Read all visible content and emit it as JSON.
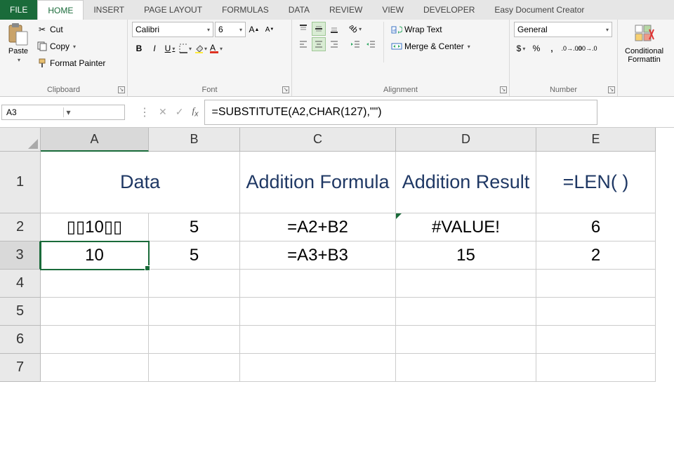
{
  "tabs": {
    "file": "FILE",
    "home": "HOME",
    "insert": "INSERT",
    "page_layout": "PAGE LAYOUT",
    "formulas": "FORMULAS",
    "data": "DATA",
    "review": "REVIEW",
    "view": "VIEW",
    "developer": "DEVELOPER",
    "easy_doc": "Easy Document Creator"
  },
  "ribbon": {
    "clipboard": {
      "label": "Clipboard",
      "paste": "Paste",
      "cut": "Cut",
      "copy": "Copy",
      "format_painter": "Format Painter"
    },
    "font": {
      "label": "Font",
      "name": "Calibri",
      "size": "6"
    },
    "alignment": {
      "label": "Alignment",
      "wrap": "Wrap Text",
      "merge": "Merge & Center"
    },
    "number": {
      "label": "Number",
      "format": "General"
    },
    "styles": {
      "cond_fmt": "Conditional\nFormatting"
    }
  },
  "formula_bar": {
    "name_box": "A3",
    "formula": "=SUBSTITUTE(A2,CHAR(127),\"\")"
  },
  "grid": {
    "columns": [
      "A",
      "B",
      "C",
      "D",
      "E"
    ],
    "rows": [
      "1",
      "2",
      "3",
      "4",
      "5",
      "6",
      "7"
    ],
    "headers": {
      "ab": "Data",
      "c": "Addition Formula",
      "d": "Addition Result",
      "e": "=LEN( )"
    },
    "r2": {
      "a": "▯▯10▯▯",
      "b": "5",
      "c": "=A2+B2",
      "d": "#VALUE!",
      "e": "6"
    },
    "r3": {
      "a": "10",
      "b": "5",
      "c": "=A3+B3",
      "d": "15",
      "e": "2"
    }
  },
  "chart_data": {
    "type": "table",
    "columns": [
      "Data(A)",
      "Data(B)",
      "Addition Formula",
      "Addition Result",
      "=LEN()"
    ],
    "rows": [
      [
        "▯▯10▯▯",
        5,
        "=A2+B2",
        "#VALUE!",
        6
      ],
      [
        10,
        5,
        "=A3+B3",
        15,
        2
      ]
    ]
  }
}
